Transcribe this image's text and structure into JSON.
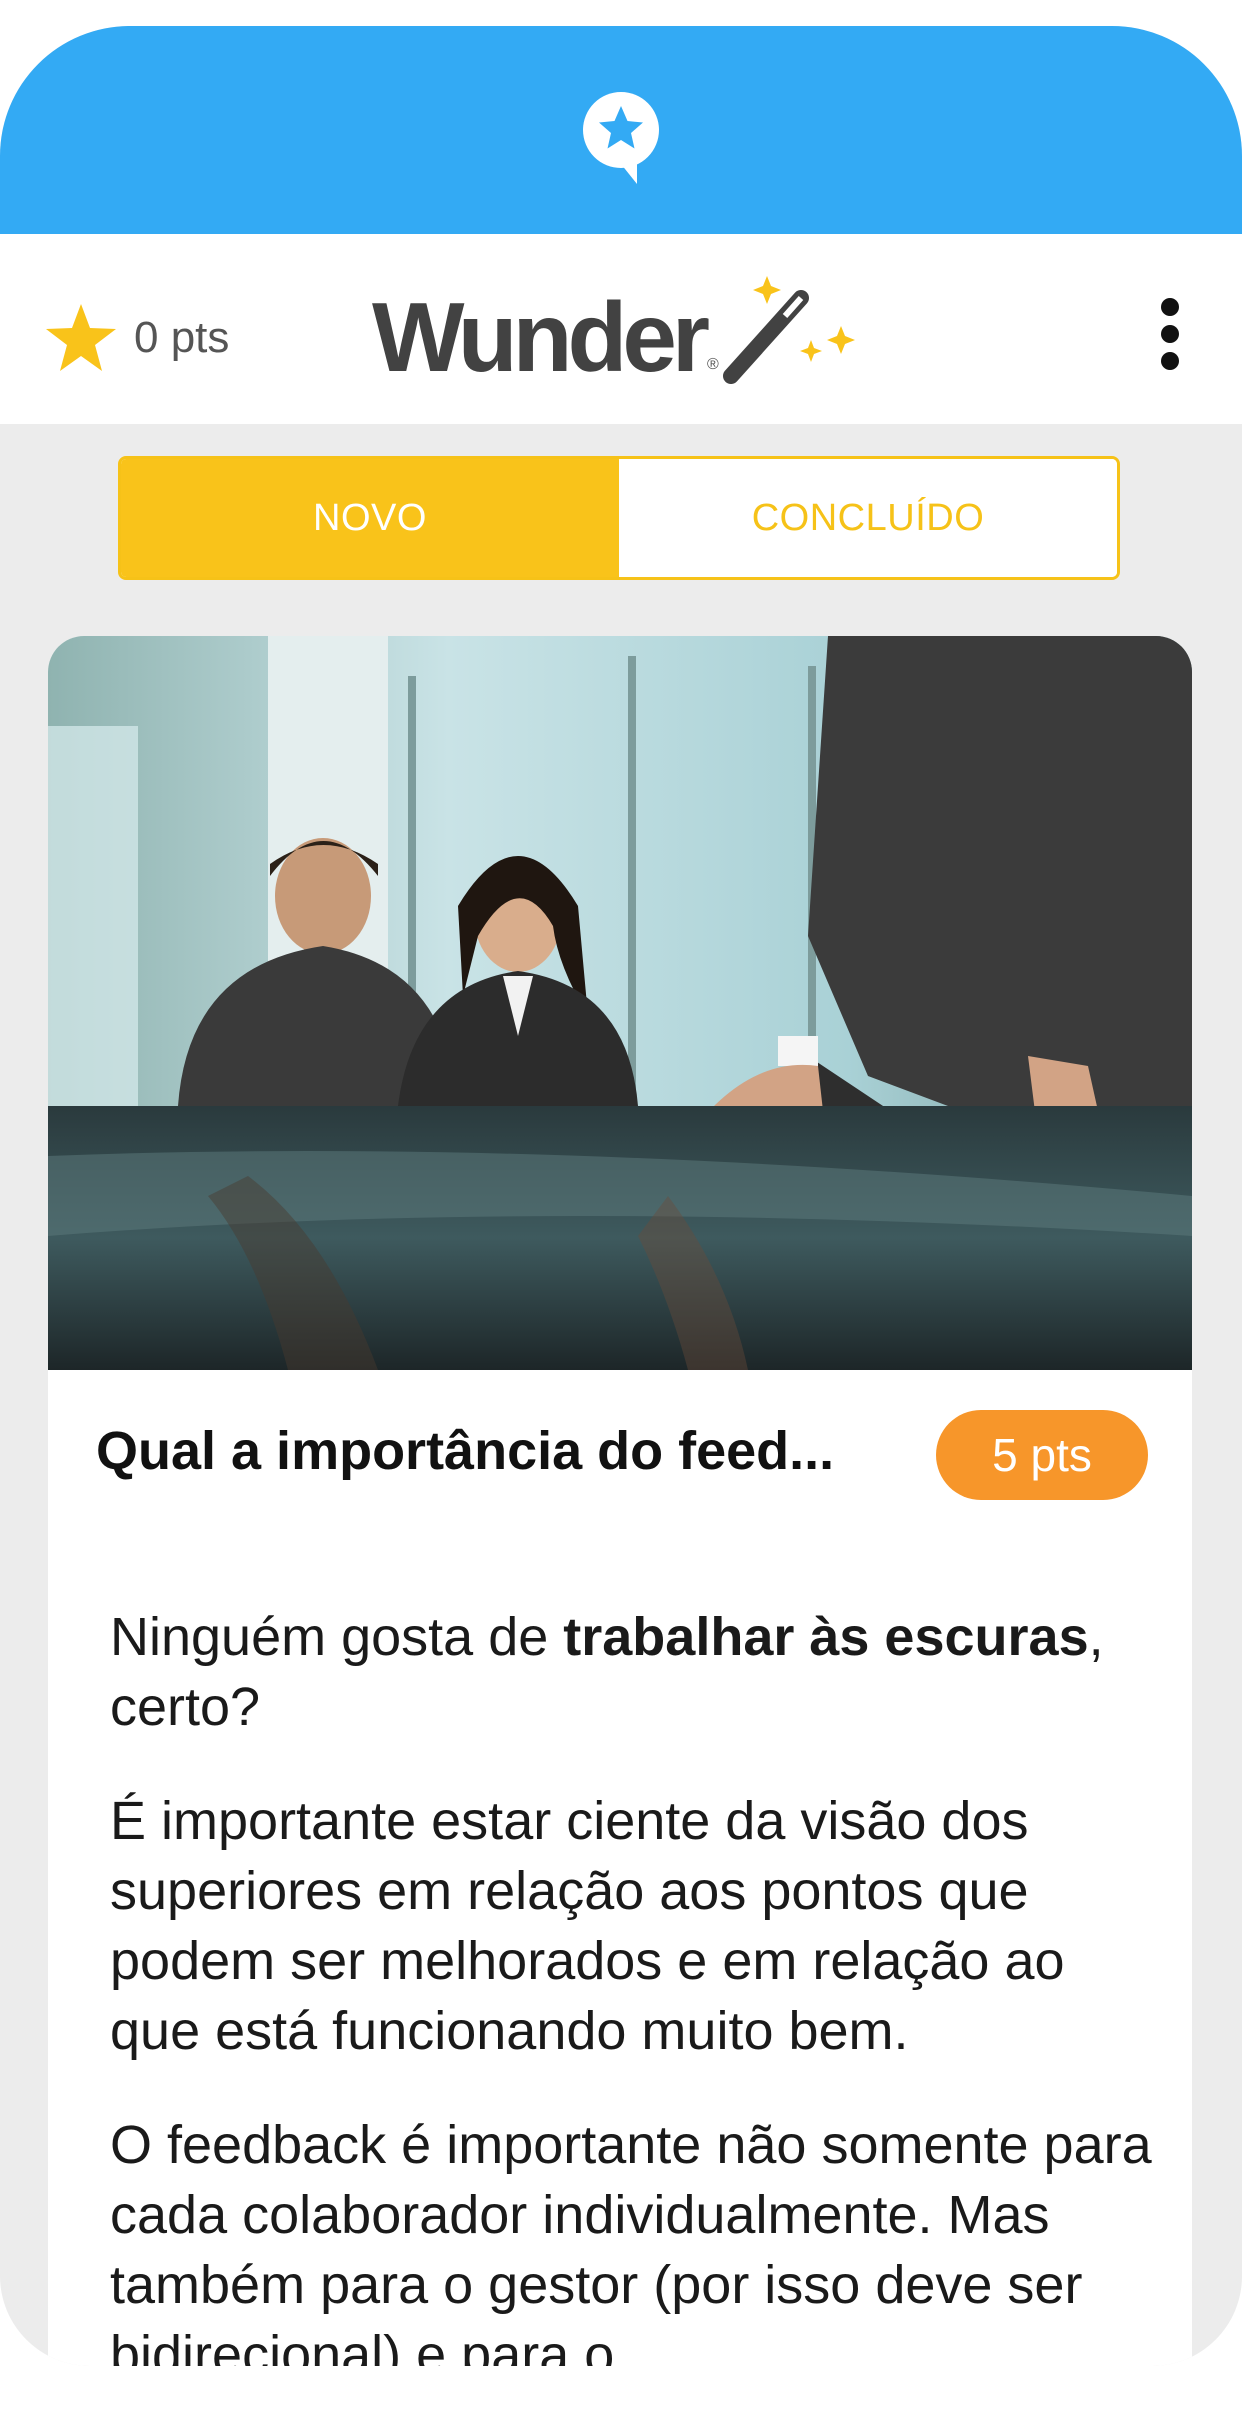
{
  "header": {
    "points_label": "0 pts",
    "logo_text": "Wunder",
    "logo_reg": "®"
  },
  "tabs": [
    {
      "label": "NOVO",
      "active": true
    },
    {
      "label": "CONCLUÍDO",
      "active": false
    }
  ],
  "card": {
    "title": "Qual a importância do feed...",
    "points_badge": "5 pts",
    "paragraphs": {
      "p1_a": "Ninguém gosta de ",
      "p1_b": "trabalhar às escuras",
      "p1_c": ", certo?",
      "p2": "É importante estar ciente da visão dos superiores em relação aos pontos que podem ser melhorados e em relação ao que está funcionando muito bem.",
      "p3": "O feedback é importante não somente para cada colaborador individualmente. Mas também para o gestor (por isso deve ser bidirecional) e para o"
    }
  },
  "colors": {
    "top_bar": "#33aaf4",
    "accent_yellow": "#f9c31a",
    "badge_orange": "#f7962a",
    "background": "#ececec"
  },
  "icons": {
    "app_badge": "star-chat-bubble-icon",
    "points": "star-icon",
    "menu": "kebab-menu-icon",
    "logo_wand": "magic-wand-icon"
  }
}
